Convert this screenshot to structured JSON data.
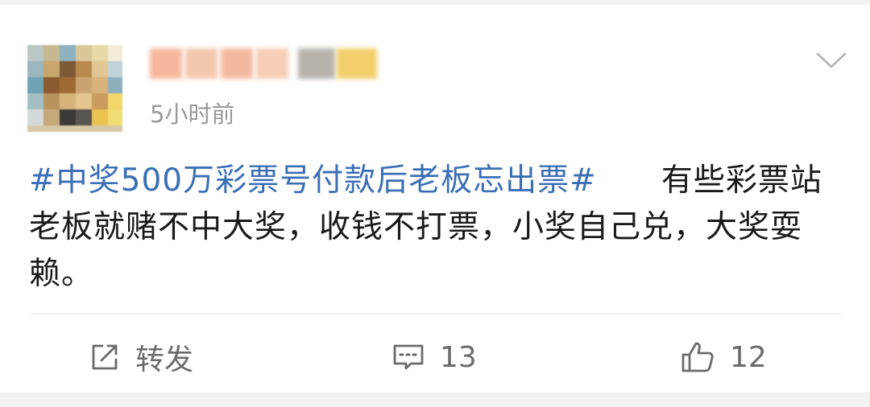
{
  "post": {
    "time": "5小时前",
    "hashtag": "#中奖500万彩票号付款后老板忘出票#",
    "gap": "　　",
    "text": "有些彩票站老板就赌不中大奖，收钱不打票，小奖自己兑，大奖耍赖。"
  },
  "actions": {
    "repost_label": "转发",
    "comment_count": "13",
    "like_count": "12"
  },
  "icons": {
    "avatar": "avatar",
    "chevron": "chevron-down-icon",
    "repost": "share-icon",
    "comment": "comment-icon",
    "like": "thumbs-up-icon"
  },
  "colors": {
    "hashtag": "#3b6fb6",
    "text": "#1a1a1a",
    "muted": "#9a9a9a",
    "action": "#6b6b6b"
  }
}
